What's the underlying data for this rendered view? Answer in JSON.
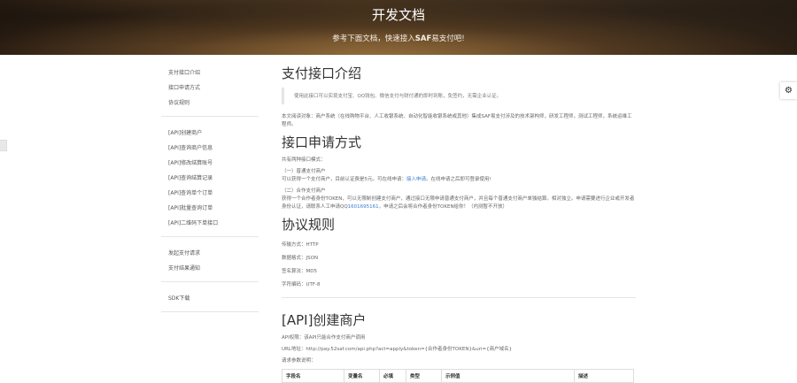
{
  "hero": {
    "title": "开发文档",
    "subtitle_prefix": "参考下面文档，快速接入",
    "subtitle_bold": "SAF",
    "subtitle_suffix": "易支付吧!"
  },
  "sidebar": {
    "groups": [
      [
        "支付接口介绍",
        "接口申请方式",
        "协议规则"
      ],
      [
        "[API]创建商户",
        "[API]查询商户信息",
        "[API]修改结算账号",
        "[API]查询结算记录",
        "[API]查询单个订单",
        "[API]批量查询订单",
        "[API]二维码下单接口"
      ],
      [
        "发起支付请求",
        "支付结果通知"
      ],
      [
        "SDK下载"
      ]
    ]
  },
  "sections": {
    "intro": {
      "heading": "支付接口介绍",
      "quote": "使用此接口可以实现支付宝、QQ钱包、微信支付与财付通的即时到账，免签约，无需企业认证。",
      "audience": "本文阅读对象：商户系统（在线购物平台、人工收银系统、自动化智能收银系统或其他）集成SAF易支付涉及的技术架构师，研发工程师，测试工程师，系统运维工程师。"
    },
    "apply": {
      "heading": "接口申请方式",
      "intro": "共有两种接口模式：",
      "mode1_title": "（一）普通支付商户",
      "mode1_text": "可以获得一个支付商户，目前认证费是5元。可在线申请：",
      "mode1_link": "接入申请",
      "mode1_suffix": "。在线申请之后即可登录使用!",
      "mode2_title": "（二）合作支付商户",
      "mode2_text": "获得一个合作者身份TOKEN，可以无限制创建支付商户，通过接口无限申请普通支付商户，并且每个普通支付商户单独结算。相对独立。申请需要进行企业或开发者身份认证，请联系人工申请QQ",
      "mode2_qq": "1601695161",
      "mode2_suffix": "，申请之后会将合作者身份TOKEN给你！（内测暂不开放）"
    },
    "rules": {
      "heading": "协议规则",
      "items": [
        "传输方式：HTTP",
        "数据格式：JSON",
        "签名算法：MD5",
        "字符编码：UTF-8"
      ]
    },
    "create": {
      "heading": "[API]创建商户",
      "permission": "API权限：该API只能合作支付商户调用",
      "url": "URL地址：http://pay.52saf.com/api.php?act=apply&token={合作者身份TOKEN}&uri={商户域名}",
      "params_title": "请求参数说明：",
      "table_headers": [
        "字段名",
        "变量名",
        "必填",
        "类型",
        "示例值",
        "描述"
      ]
    }
  },
  "ui": {
    "gear_icon": "⚙"
  }
}
